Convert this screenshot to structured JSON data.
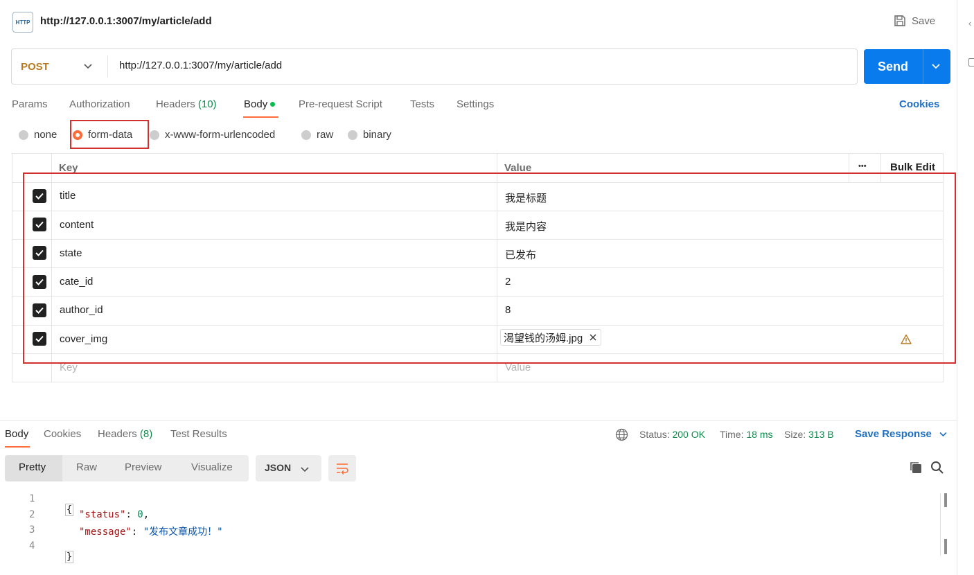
{
  "header": {
    "badge": "HTTP",
    "title": "http://127.0.0.1:3007/my/article/add",
    "save_label": "Save"
  },
  "request": {
    "method": "POST",
    "url": "http://127.0.0.1:3007/my/article/add",
    "send_label": "Send"
  },
  "tabs": {
    "params": "Params",
    "authorization": "Authorization",
    "headers": "Headers",
    "headers_count": "(10)",
    "body": "Body",
    "prerequest": "Pre-request Script",
    "tests": "Tests",
    "settings": "Settings",
    "cookies": "Cookies"
  },
  "body_types": {
    "none": "none",
    "form_data": "form-data",
    "urlencoded": "x-www-form-urlencoded",
    "raw": "raw",
    "binary": "binary",
    "selected": "form-data"
  },
  "table": {
    "key_header": "Key",
    "value_header": "Value",
    "more": "•••",
    "bulk_edit": "Bulk Edit",
    "rows": [
      {
        "key": "title",
        "value": "我是标题",
        "checked": true
      },
      {
        "key": "content",
        "value": "我是内容",
        "checked": true
      },
      {
        "key": "state",
        "value": "已发布",
        "checked": true
      },
      {
        "key": "cate_id",
        "value": "2",
        "checked": true
      },
      {
        "key": "author_id",
        "value": "8",
        "checked": true
      },
      {
        "key": "cover_img",
        "value": "渴望钱的汤姆.jpg",
        "checked": true,
        "is_file": true
      }
    ],
    "placeholder_key": "Key",
    "placeholder_value": "Value"
  },
  "response": {
    "tabs": {
      "body": "Body",
      "cookies": "Cookies",
      "headers": "Headers",
      "headers_count": "(8)",
      "test_results": "Test Results"
    },
    "status_label": "Status:",
    "status_value": "200 OK",
    "time_label": "Time:",
    "time_value": "18 ms",
    "size_label": "Size:",
    "size_value": "313 B",
    "save_response": "Save Response",
    "views": {
      "pretty": "Pretty",
      "raw": "Raw",
      "preview": "Preview",
      "visualize": "Visualize"
    },
    "format": "JSON",
    "code": {
      "line_numbers": [
        "1",
        "2",
        "3",
        "4"
      ],
      "open_brace": "{",
      "key1": "\"status\"",
      "val1": "0",
      "key2": "\"message\"",
      "val2": "\"发布文章成功！\"",
      "close_brace": "}"
    }
  },
  "colors": {
    "accent": "#ff6c37",
    "send": "#097bed",
    "link": "#1f6fc5",
    "status_green": "#0e8a4a",
    "annotation_red": "#d32f2f",
    "method": "#b7791f"
  }
}
